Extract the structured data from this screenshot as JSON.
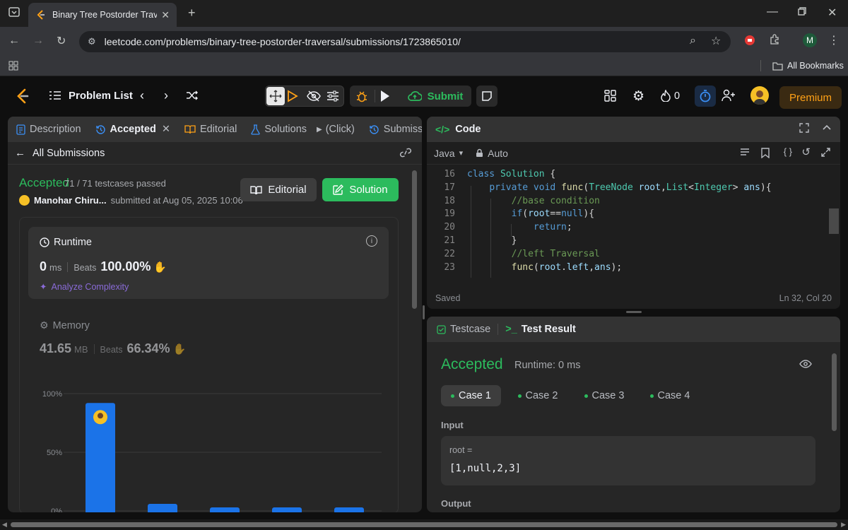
{
  "browser": {
    "tab_title": "Binary Tree Postorder Traversal",
    "url": "leetcode.com/problems/binary-tree-postorder-traversal/submissions/1723865010/",
    "all_bookmarks": "All Bookmarks",
    "profile_initial": "M"
  },
  "nav": {
    "problem_list": "Problem List",
    "submit": "Submit",
    "streak": "0",
    "premium": "Premium"
  },
  "left_tabs": {
    "description": "Description",
    "accepted": "Accepted",
    "editorial": "Editorial",
    "solutions": "Solutions",
    "click": "(Click)",
    "submissions": "Submissi"
  },
  "submission": {
    "back": "All Submissions",
    "status": "Accepted",
    "testcases": "71 / 71 testcases passed",
    "author": "Manohar Chiru...",
    "submitted_at": "submitted at Aug 05, 2025 10:06",
    "editorial_btn": "Editorial",
    "solution_btn": "Solution"
  },
  "runtime": {
    "label": "Runtime",
    "value": "0",
    "unit": "ms",
    "beats_label": "Beats",
    "beats": "100.00%",
    "analyze": "Analyze Complexity"
  },
  "memory": {
    "label": "Memory",
    "value": "41.65",
    "unit": "MB",
    "beats_label": "Beats",
    "beats": "66.34%"
  },
  "chart_data": {
    "type": "bar",
    "y_ticks": [
      "100%",
      "50%",
      "0%"
    ],
    "ylim": [
      0,
      100
    ],
    "values": [
      92,
      6,
      3,
      3,
      3
    ],
    "highlight_index": 0,
    "colors": {
      "bar": "#1b73e8",
      "grid": "#3a3a3a"
    }
  },
  "code": {
    "title": "Code",
    "language": "Java",
    "mode": "Auto",
    "status": "Saved",
    "cursor": "Ln 32, Col 20",
    "lines": [
      {
        "n": "16",
        "html": "<span class='kw'>class</span> <span class='ty'>Solution</span> {"
      },
      {
        "n": "17",
        "html": "    <span class='kw'>private void</span> <span class='fn'>func</span>(<span class='ty'>TreeNode</span> <span class='pm'>root</span>,<span class='ty'>List</span>&lt;<span class='ty'>Integer</span>&gt; <span class='pm'>ans</span>){"
      },
      {
        "n": "18",
        "html": "        <span class='cm'>//base condition</span>"
      },
      {
        "n": "19",
        "html": "        <span class='kw'>if</span>(<span class='pm'>root</span>==<span class='kw'>null</span>){"
      },
      {
        "n": "20",
        "html": "            <span class='kw'>return</span>;"
      },
      {
        "n": "21",
        "html": "        }"
      },
      {
        "n": "22",
        "html": "        <span class='cm'>//left Traversal</span>"
      },
      {
        "n": "23",
        "html": "        <span class='fn'>func</span>(<span class='pm'>root</span>.<span class='pm'>left</span>,<span class='pm'>ans</span>);"
      }
    ]
  },
  "test": {
    "testcase_tab": "Testcase",
    "result_tab": "Test Result",
    "status": "Accepted",
    "runtime": "Runtime: 0 ms",
    "cases": [
      "Case 1",
      "Case 2",
      "Case 3",
      "Case 4"
    ],
    "input_label": "Input",
    "var_name": "root =",
    "var_value": "[1,null,2,3]",
    "output_label": "Output"
  },
  "colors": {
    "accent_green": "#2cbb5d",
    "premium": "#ffa116",
    "analyze": "#8a6bd8"
  }
}
